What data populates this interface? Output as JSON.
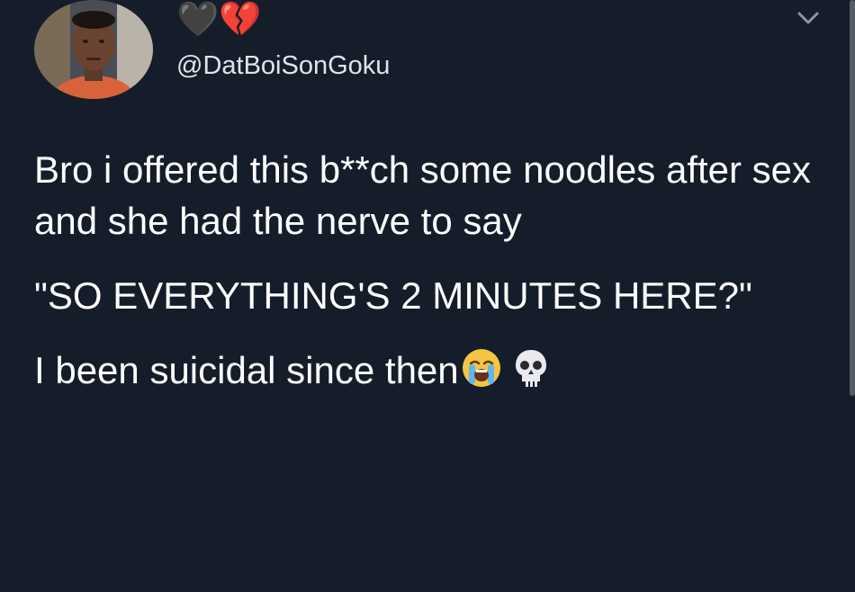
{
  "tweet": {
    "display_name": "🖤💔",
    "handle": "@DatBoiSonGoku",
    "paragraphs": [
      "Bro i offered this b**ch some noodles after sex and she had the nerve to say",
      "\"SO EVERYTHING'S 2 MINUTES HERE?\"",
      "I been suicidal since then"
    ],
    "trailing_emoji": [
      "loudly-crying-face-icon",
      "skull-icon"
    ]
  },
  "colors": {
    "background": "#151d2b",
    "text": "#ffffff",
    "handle": "#dfe3ea"
  }
}
